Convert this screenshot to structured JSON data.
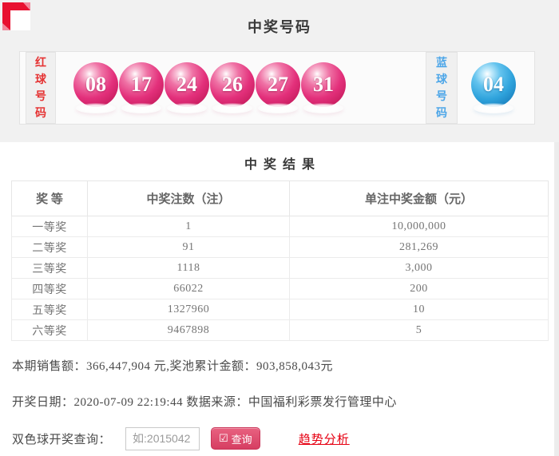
{
  "banner": {
    "title": "中奖号码"
  },
  "balls": {
    "red_label": "红球号码",
    "blue_label": "蓝球号码",
    "red": [
      "08",
      "17",
      "24",
      "26",
      "27",
      "31"
    ],
    "blue": [
      "04"
    ]
  },
  "results": {
    "title": "中奖结果",
    "table": {
      "headers": [
        "奖 等",
        "中奖注数（注）",
        "单注中奖金额（元）"
      ],
      "rows": [
        {
          "tier": "一等奖",
          "count": "1",
          "amount": "10,000,000"
        },
        {
          "tier": "二等奖",
          "count": "91",
          "amount": "281,269"
        },
        {
          "tier": "三等奖",
          "count": "1118",
          "amount": "3,000"
        },
        {
          "tier": "四等奖",
          "count": "66022",
          "amount": "200"
        },
        {
          "tier": "五等奖",
          "count": "1327960",
          "amount": "10"
        },
        {
          "tier": "六等奖",
          "count": "9467898",
          "amount": "5"
        }
      ]
    }
  },
  "footer": {
    "sales_line": "本期销售额：366,447,904 元,奖池累计金额：903,858,043元",
    "draw_line": "开奖日期：2020-07-09 22:19:44 数据来源：中国福利彩票发行管理中心",
    "query_label": "双色球开奖查询：",
    "query_placeholder": "如:2015042",
    "query_button": "查询",
    "check_icon": "☑",
    "trend_link": "趋势分析"
  },
  "colors": {
    "accent_red": "#e81130",
    "ribbon_bevel": "#f2899c",
    "ball_red": "#e3307b",
    "ball_blue": "#2fa3dc",
    "red_label_text": "#e53333",
    "blue_label_text": "#4da6e8",
    "button_bg": "#d94866",
    "link_red": "#e60012",
    "banner_bg": "#f1f1f1"
  }
}
